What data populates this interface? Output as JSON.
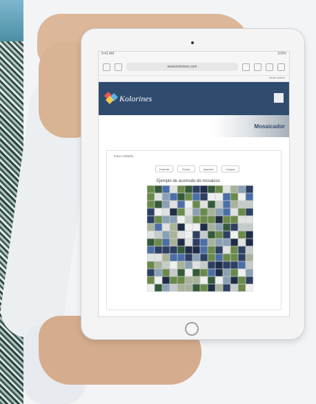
{
  "scene": {
    "colors": {
      "skin": "#d8b394",
      "sleeve": "#eceff2",
      "tablet": "#f4f4f4",
      "header": "#2f4b6e"
    }
  },
  "browser": {
    "address": "www.kolorines.com",
    "status_left": "9:41 AM",
    "status_right": "100%",
    "subbar_text": "Iniciar sesión"
  },
  "site": {
    "logo_text": "Kolorines",
    "banner_title": "Mosaicador",
    "breadcrumb": "Inicio / Diseño",
    "buttons": [
      "Guardar",
      "Enviar",
      "Imprimir",
      "Limpiar"
    ],
    "caption": "Ejemplo de acomodo de mosaicos",
    "mosaic_palette": [
      "#2d3f63",
      "#4a6fa8",
      "#dfe2e0",
      "#c5cbc8",
      "#6a8a4a",
      "#35593a",
      "#8aa0b4",
      "#a8b39a",
      "#1f2d47",
      "#eef0ee"
    ]
  }
}
